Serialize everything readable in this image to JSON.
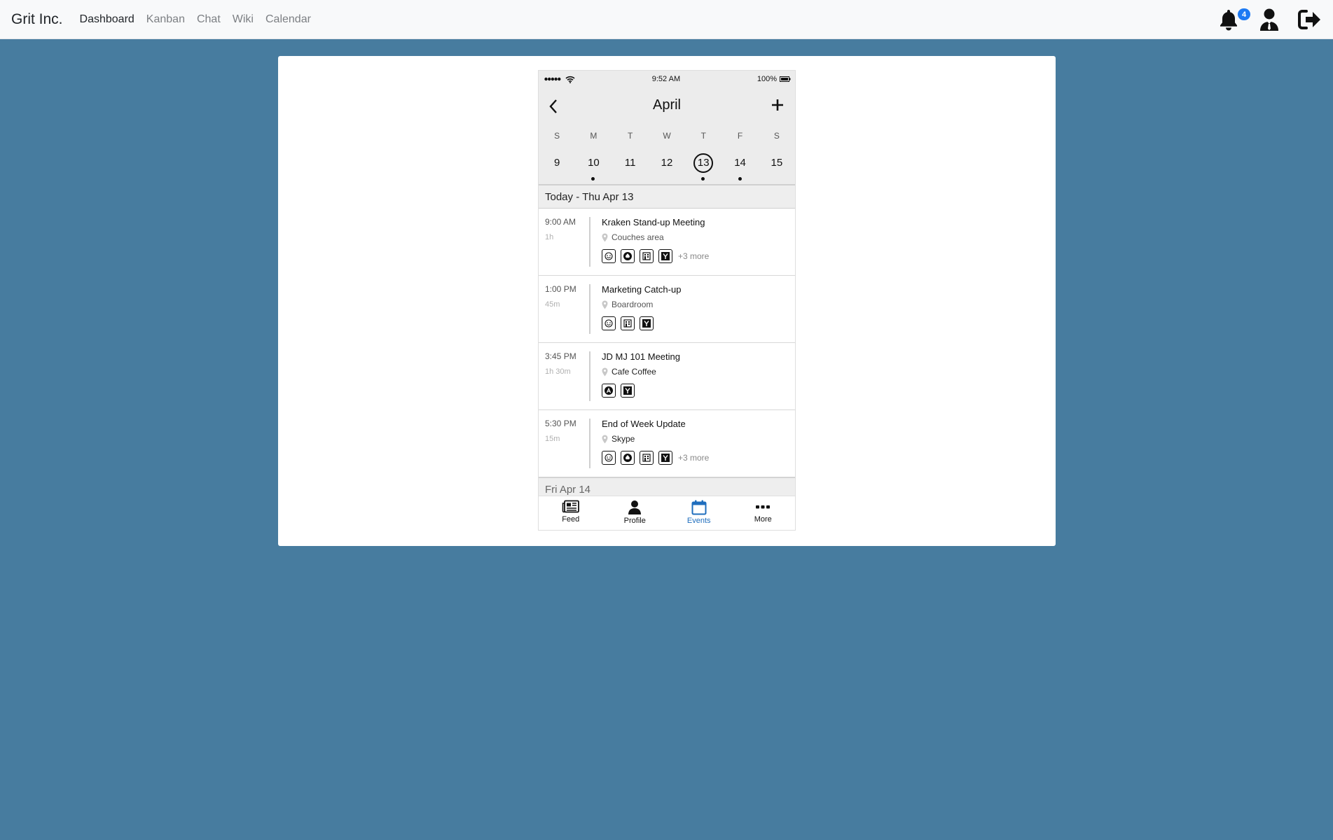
{
  "navbar": {
    "brand": "Grit Inc.",
    "links": [
      {
        "label": "Dashboard",
        "active": true
      },
      {
        "label": "Kanban",
        "active": false
      },
      {
        "label": "Chat",
        "active": false
      },
      {
        "label": "Wiki",
        "active": false
      },
      {
        "label": "Calendar",
        "active": false
      }
    ],
    "notification_count": "4",
    "icons": [
      "bell-icon",
      "user-suit-icon",
      "sign-out-icon"
    ]
  },
  "phone": {
    "status": {
      "time": "9:52 AM",
      "battery": "100%"
    },
    "header": {
      "month": "April"
    },
    "weekdays": [
      "S",
      "M",
      "T",
      "W",
      "T",
      "F",
      "S"
    ],
    "days": [
      {
        "num": "9",
        "dot": false,
        "today": false
      },
      {
        "num": "10",
        "dot": true,
        "today": false
      },
      {
        "num": "11",
        "dot": false,
        "today": false
      },
      {
        "num": "12",
        "dot": false,
        "today": false
      },
      {
        "num": "13",
        "dot": true,
        "today": true
      },
      {
        "num": "14",
        "dot": true,
        "today": false
      },
      {
        "num": "15",
        "dot": false,
        "today": false
      }
    ],
    "today_header": "Today - Thu Apr 13",
    "events": [
      {
        "time": "9:00 AM",
        "duration": "1h",
        "title": "Kraken Stand-up Meeting",
        "location": "Couches area",
        "attendees": [
          "smiley-icon",
          "spade-icon",
          "building-icon",
          "y-icon"
        ],
        "more": "+3 more"
      },
      {
        "time": "1:00 PM",
        "duration": "45m",
        "title": "Marketing Catch-up",
        "location": "Boardroom",
        "attendees": [
          "smiley-icon",
          "building-icon",
          "y-icon"
        ],
        "more": ""
      },
      {
        "time": "3:45 PM",
        "duration": "1h 30m",
        "title": "JD MJ 101 Meeting",
        "location": "Cafe Coffee",
        "attendees": [
          "a-icon",
          "y-icon"
        ],
        "more": ""
      },
      {
        "time": "5:30 PM",
        "duration": "15m",
        "title": "End of Week Update",
        "location": "Skype",
        "attendees": [
          "smiley-icon",
          "spade-icon",
          "building-icon",
          "y-icon"
        ],
        "more": "+3 more"
      }
    ],
    "next_header": "Fri Apr 14",
    "tabs": [
      {
        "label": "Feed",
        "icon": "newspaper-icon",
        "active": false
      },
      {
        "label": "Profile",
        "icon": "person-icon",
        "active": false
      },
      {
        "label": "Events",
        "icon": "calendar-icon",
        "active": true
      },
      {
        "label": "More",
        "icon": "ellipsis-icon",
        "active": false
      }
    ]
  },
  "colors": {
    "background": "#477c9f",
    "accent": "#1e6dbd",
    "badge": "#1d7af3"
  }
}
